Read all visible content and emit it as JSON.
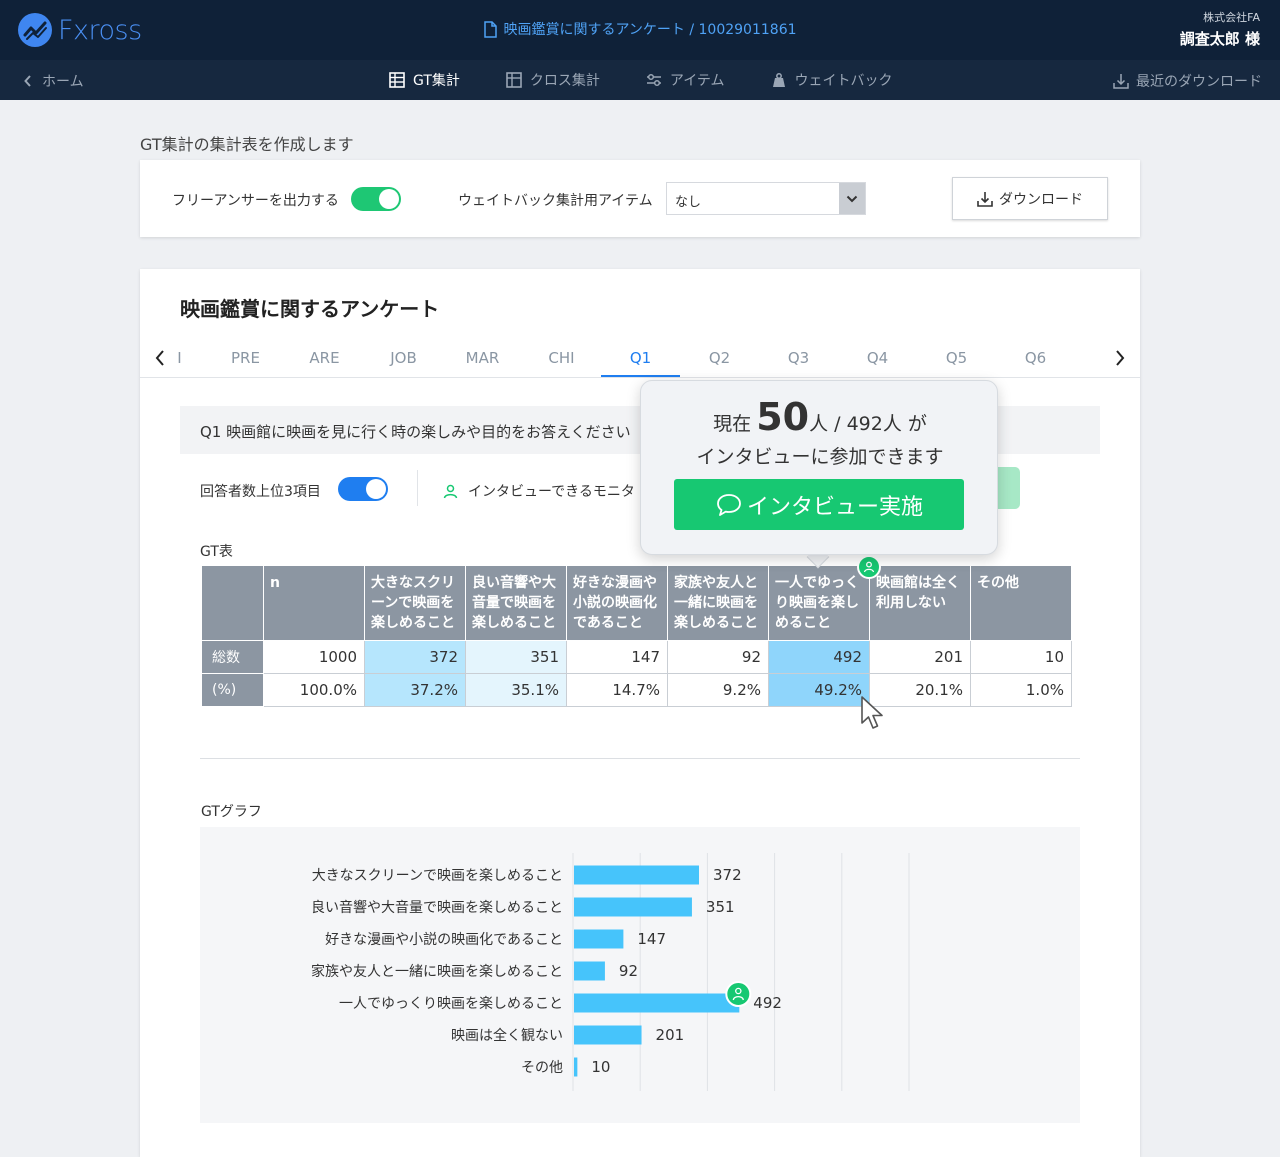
{
  "header": {
    "logo_text": "Fxross",
    "doc_title": "映画鑑賞に関するアンケート / 10029011861",
    "company": "株式会社FA",
    "user_name": "調査太郎 様"
  },
  "nav": {
    "home": "ホーム",
    "tabs": [
      {
        "label": "GT集計",
        "icon": "table-icon",
        "active": true
      },
      {
        "label": "クロス集計",
        "icon": "grid-icon",
        "active": false
      },
      {
        "label": "アイテム",
        "icon": "sliders-icon",
        "active": false
      },
      {
        "label": "ウェイトバック",
        "icon": "weight-icon",
        "active": false
      }
    ],
    "recent_download": "最近のダウンロード"
  },
  "section_title": "GT集計の集計表を作成します",
  "settings": {
    "free_answer_label": "フリーアンサーを出力する",
    "free_answer_on": true,
    "weightback_label": "ウェイトバック集計用アイテム",
    "weightback_value": "なし",
    "download_label": "ダウンロード"
  },
  "main": {
    "title": "映画鑑賞に関するアンケート",
    "tabs": [
      "I",
      "PRE",
      "ARE",
      "JOB",
      "MAR",
      "CHI",
      "Q1",
      "Q2",
      "Q3",
      "Q4",
      "Q5",
      "Q6"
    ],
    "active_tab": "Q1",
    "question": "Q1 映画館に映画を見に行く時の楽しみや目的をお答えください",
    "top3_label": "回答者数上位3項目",
    "top3_on": true,
    "monitor_label": "インタビューできるモニタ",
    "gt_label": "GT表",
    "graph_label": "GTグラフ"
  },
  "gt_table": {
    "headers": [
      "n",
      "大きなスクリーンで映画を楽しめること",
      "良い音響や大音量で映画を楽しめること",
      "好きな漫画や小説の映画化であること",
      "家族や友人と一緒に映画を楽しめること",
      "一人でゆっくり映画を楽しめること",
      "映画館は全く利用しない",
      "その他"
    ],
    "rows": [
      {
        "label": "総数",
        "cells": [
          "1000",
          "372",
          "351",
          "147",
          "92",
          "492",
          "201",
          "10"
        ]
      },
      {
        "label": "(%)",
        "cells": [
          "100.0%",
          "37.2%",
          "35.1%",
          "14.7%",
          "9.2%",
          "49.2%",
          "20.1%",
          "1.0%"
        ]
      }
    ]
  },
  "popover": {
    "prefix": "現在",
    "count": "50",
    "middle": "人 / 492人 が",
    "line2": "インタビューに参加できます",
    "button": "インタビュー実施"
  },
  "colors": {
    "header_bg": "#0f2138",
    "accent_blue": "#1f7ef0",
    "accent_green": "#17c872",
    "bar": "#46c4fb"
  },
  "chart_data": {
    "type": "bar",
    "orientation": "horizontal",
    "categories": [
      "大きなスクリーンで映画を楽しめること",
      "良い音響や大音量で映画を楽しめること",
      "好きな漫画や小説の映画化であること",
      "家族や友人と一緒に映画を楽しめること",
      "一人でゆっくり映画を楽しめること",
      "映画は全く観ない",
      "その他"
    ],
    "values": [
      372,
      351,
      147,
      92,
      492,
      201,
      10
    ],
    "xlim": [
      0,
      1000
    ],
    "grid": true
  }
}
